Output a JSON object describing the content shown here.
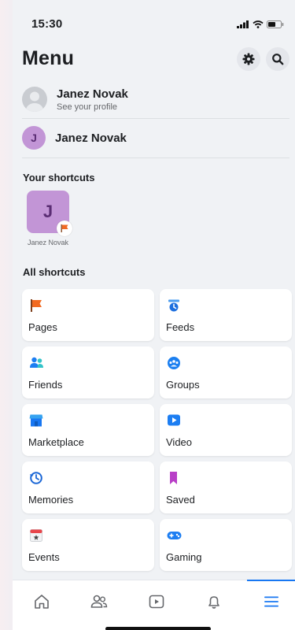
{
  "status": {
    "time": "15:30"
  },
  "header": {
    "title": "Menu",
    "settings_icon": "gear-icon",
    "search_icon": "search-icon"
  },
  "profile": {
    "name": "Janez Novak",
    "subtitle": "See your profile"
  },
  "page": {
    "initial": "J",
    "name": "Janez Novak"
  },
  "your_shortcuts": {
    "label": "Your shortcuts",
    "items": [
      {
        "initial": "J",
        "label": "Janez Novak"
      }
    ]
  },
  "all_shortcuts": {
    "label": "All shortcuts",
    "items": [
      {
        "label": "Pages",
        "icon": "flag-icon"
      },
      {
        "label": "Feeds",
        "icon": "feeds-icon"
      },
      {
        "label": "Friends",
        "icon": "friends-icon"
      },
      {
        "label": "Groups",
        "icon": "groups-icon"
      },
      {
        "label": "Marketplace",
        "icon": "store-icon"
      },
      {
        "label": "Video",
        "icon": "video-icon"
      },
      {
        "label": "Memories",
        "icon": "clock-icon"
      },
      {
        "label": "Saved",
        "icon": "bookmark-icon"
      },
      {
        "label": "Events",
        "icon": "calendar-icon"
      },
      {
        "label": "Gaming",
        "icon": "gamepad-icon"
      }
    ]
  },
  "tabbar": {
    "tabs": [
      "home-icon",
      "friends-tab-icon",
      "video-tab-icon",
      "bell-icon",
      "menu-icon"
    ],
    "active": "menu-icon"
  },
  "colors": {
    "accent": "#1877f2",
    "page_avatar": "#c295d6",
    "background": "#f0f2f5"
  }
}
